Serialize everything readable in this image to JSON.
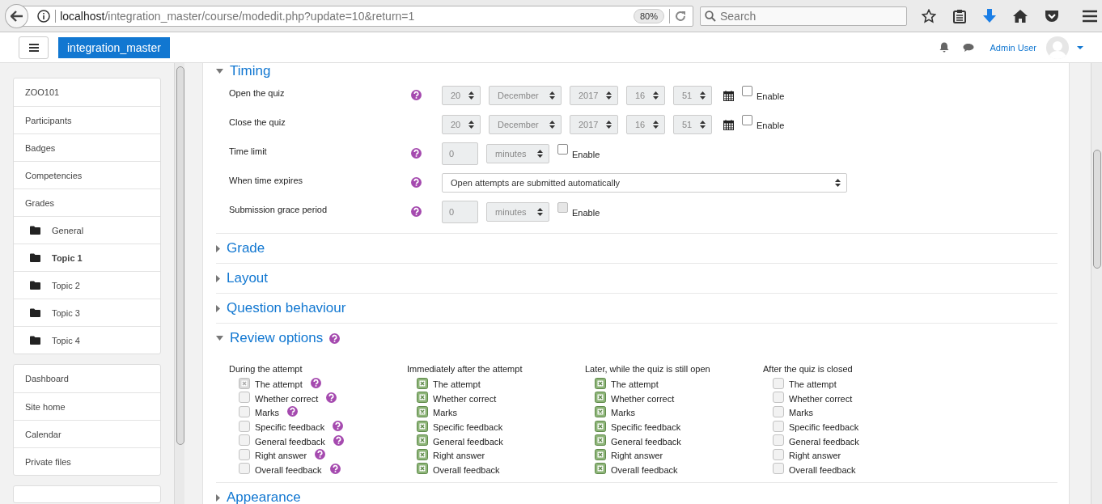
{
  "browser": {
    "url_host": "localhost",
    "url_path": "/integration_master/course/modedit.php?update=10&return=1",
    "zoom": "80%",
    "search_placeholder": "Search"
  },
  "header": {
    "site_name": "integration_master",
    "user_name": "Admin User"
  },
  "sidebar": {
    "groups": [
      {
        "items": [
          {
            "label": "ZOO101",
            "kind": "link",
            "selected": false
          },
          {
            "label": "Participants",
            "kind": "link",
            "selected": false
          },
          {
            "label": "Badges",
            "kind": "link",
            "selected": false
          },
          {
            "label": "Competencies",
            "kind": "link",
            "selected": false
          },
          {
            "label": "Grades",
            "kind": "link",
            "selected": false
          },
          {
            "label": "General",
            "kind": "folder",
            "selected": false
          },
          {
            "label": "Topic 1",
            "kind": "folder",
            "selected": true
          },
          {
            "label": "Topic 2",
            "kind": "folder",
            "selected": false
          },
          {
            "label": "Topic 3",
            "kind": "folder",
            "selected": false
          },
          {
            "label": "Topic 4",
            "kind": "folder",
            "selected": false
          }
        ]
      },
      {
        "items": [
          {
            "label": "Dashboard",
            "kind": "link",
            "selected": false
          },
          {
            "label": "Site home",
            "kind": "link",
            "selected": false
          },
          {
            "label": "Calendar",
            "kind": "link",
            "selected": false
          },
          {
            "label": "Private files",
            "kind": "link",
            "selected": false
          }
        ]
      }
    ]
  },
  "sections": [
    {
      "title": "Timing",
      "expanded": true,
      "help": false,
      "fields": [
        {
          "kind": "datetime",
          "label": "Open the quiz",
          "help": true,
          "disabled": true,
          "selects": [
            "20",
            "December",
            "2017",
            "16",
            "51"
          ],
          "enable": {
            "label": "Enable",
            "checked": false,
            "disabled": false
          }
        },
        {
          "kind": "datetime",
          "label": "Close the quiz",
          "help": false,
          "disabled": true,
          "selects": [
            "20",
            "December",
            "2017",
            "16",
            "51"
          ],
          "enable": {
            "label": "Enable",
            "checked": false,
            "disabled": false
          }
        },
        {
          "kind": "duration",
          "label": "Time limit",
          "help": true,
          "disabled": true,
          "value": "0",
          "unit": "minutes",
          "enable": {
            "label": "Enable",
            "checked": false,
            "disabled": false
          }
        },
        {
          "kind": "select",
          "label": "When time expires",
          "help": true,
          "disabled": false,
          "value": "Open attempts are submitted automatically"
        },
        {
          "kind": "duration",
          "label": "Submission grace period",
          "help": true,
          "disabled": true,
          "value": "0",
          "unit": "minutes",
          "enable": {
            "label": "Enable",
            "checked": false,
            "disabled": true
          }
        }
      ]
    },
    {
      "title": "Grade",
      "expanded": false,
      "help": false
    },
    {
      "title": "Layout",
      "expanded": false,
      "help": false
    },
    {
      "title": "Question behaviour",
      "expanded": false,
      "help": false
    },
    {
      "title": "Review options",
      "expanded": true,
      "help": true,
      "columns": [
        {
          "title": "During the attempt",
          "items": [
            {
              "label": "The attempt",
              "checked": true,
              "disabled": true,
              "help": true
            },
            {
              "label": "Whether correct",
              "checked": false,
              "disabled": false,
              "help": true
            },
            {
              "label": "Marks",
              "checked": false,
              "disabled": false,
              "help": true
            },
            {
              "label": "Specific feedback",
              "checked": false,
              "disabled": false,
              "help": true
            },
            {
              "label": "General feedback",
              "checked": false,
              "disabled": false,
              "help": true
            },
            {
              "label": "Right answer",
              "checked": false,
              "disabled": false,
              "help": true
            },
            {
              "label": "Overall feedback",
              "checked": false,
              "disabled": false,
              "help": true
            }
          ]
        },
        {
          "title": "Immediately after the attempt",
          "items": [
            {
              "label": "The attempt",
              "checked": true,
              "disabled": false,
              "help": false
            },
            {
              "label": "Whether correct",
              "checked": true,
              "disabled": false,
              "help": false
            },
            {
              "label": "Marks",
              "checked": true,
              "disabled": false,
              "help": false
            },
            {
              "label": "Specific feedback",
              "checked": true,
              "disabled": false,
              "help": false
            },
            {
              "label": "General feedback",
              "checked": true,
              "disabled": false,
              "help": false
            },
            {
              "label": "Right answer",
              "checked": true,
              "disabled": false,
              "help": false
            },
            {
              "label": "Overall feedback",
              "checked": true,
              "disabled": false,
              "help": false
            }
          ]
        },
        {
          "title": "Later, while the quiz is still open",
          "items": [
            {
              "label": "The attempt",
              "checked": true,
              "disabled": false,
              "help": false
            },
            {
              "label": "Whether correct",
              "checked": true,
              "disabled": false,
              "help": false
            },
            {
              "label": "Marks",
              "checked": true,
              "disabled": false,
              "help": false
            },
            {
              "label": "Specific feedback",
              "checked": true,
              "disabled": false,
              "help": false
            },
            {
              "label": "General feedback",
              "checked": true,
              "disabled": false,
              "help": false
            },
            {
              "label": "Right answer",
              "checked": true,
              "disabled": false,
              "help": false
            },
            {
              "label": "Overall feedback",
              "checked": true,
              "disabled": false,
              "help": false
            }
          ]
        },
        {
          "title": "After the quiz is closed",
          "items": [
            {
              "label": "The attempt",
              "checked": false,
              "disabled": false,
              "help": false
            },
            {
              "label": "Whether correct",
              "checked": false,
              "disabled": false,
              "help": false
            },
            {
              "label": "Marks",
              "checked": false,
              "disabled": false,
              "help": false
            },
            {
              "label": "Specific feedback",
              "checked": false,
              "disabled": false,
              "help": false
            },
            {
              "label": "General feedback",
              "checked": false,
              "disabled": false,
              "help": false
            },
            {
              "label": "Right answer",
              "checked": false,
              "disabled": false,
              "help": false
            },
            {
              "label": "Overall feedback",
              "checked": false,
              "disabled": false,
              "help": false
            }
          ]
        }
      ]
    },
    {
      "title": "Appearance",
      "expanded": false,
      "help": false
    }
  ]
}
